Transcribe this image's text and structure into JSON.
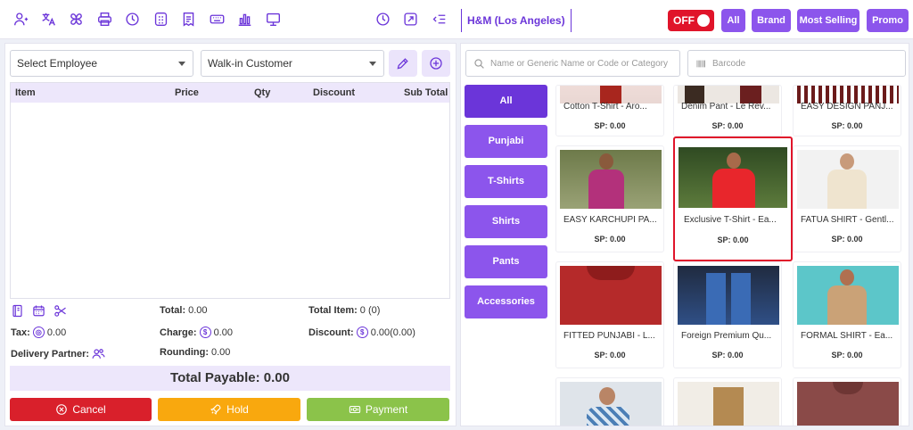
{
  "store_name": "H&M (Los Angeles)",
  "toggle_label": "OFF",
  "filters": [
    "All",
    "Brand",
    "Most Selling",
    "Promo"
  ],
  "employee_select": "Select Employee",
  "customer_select": "Walk-in Customer",
  "table_headers": [
    "Item",
    "Price",
    "Qty",
    "Discount",
    "Sub Total"
  ],
  "summary": {
    "total_label": "Total:",
    "total_value": "0.00",
    "total_item_label": "Total Item:",
    "total_item_value": "0 (0)",
    "tax_label": "Tax:",
    "tax_value": "0.00",
    "charge_label": "Charge:",
    "charge_value": "0.00",
    "discount_label": "Discount:",
    "discount_value": "0.00(0.00)",
    "delivery_label": "Delivery Partner:",
    "rounding_label": "Rounding:",
    "rounding_value": "0.00"
  },
  "total_payable": "Total Payable: 0.00",
  "actions": {
    "cancel": "Cancel",
    "hold": "Hold",
    "payment": "Payment"
  },
  "search_placeholder": "Name or Generic Name or Code or Category",
  "barcode_placeholder": "Barcode",
  "categories": [
    "All",
    "Punjabi",
    "T-Shirts",
    "Shirts",
    "Pants",
    "Accessories"
  ],
  "products": [
    {
      "name": "Cotton T-Shirt - Aro...",
      "price": "SP: 0.00"
    },
    {
      "name": "Denim Pant - Le Rev...",
      "price": "SP: 0.00"
    },
    {
      "name": "EASY DESIGN PANJ...",
      "price": "SP: 0.00"
    },
    {
      "name": "EASY KARCHUPI PA...",
      "price": "SP: 0.00"
    },
    {
      "name": "Exclusive T-Shirt - Ea...",
      "price": "SP: 0.00"
    },
    {
      "name": "FATUA SHIRT - Gentl...",
      "price": "SP: 0.00"
    },
    {
      "name": "FITTED PUNJABI - L...",
      "price": "SP: 0.00"
    },
    {
      "name": "Foreign Premium Qu...",
      "price": "SP: 0.00"
    },
    {
      "name": "FORMAL SHIRT - Ea...",
      "price": "SP: 0.00"
    }
  ],
  "colors": {
    "accent": "#6b35d9",
    "accent_light": "#8c55ec",
    "cancel": "#d9202b",
    "hold": "#f9a80e",
    "payment": "#8bc34a",
    "off": "#e0142a"
  }
}
